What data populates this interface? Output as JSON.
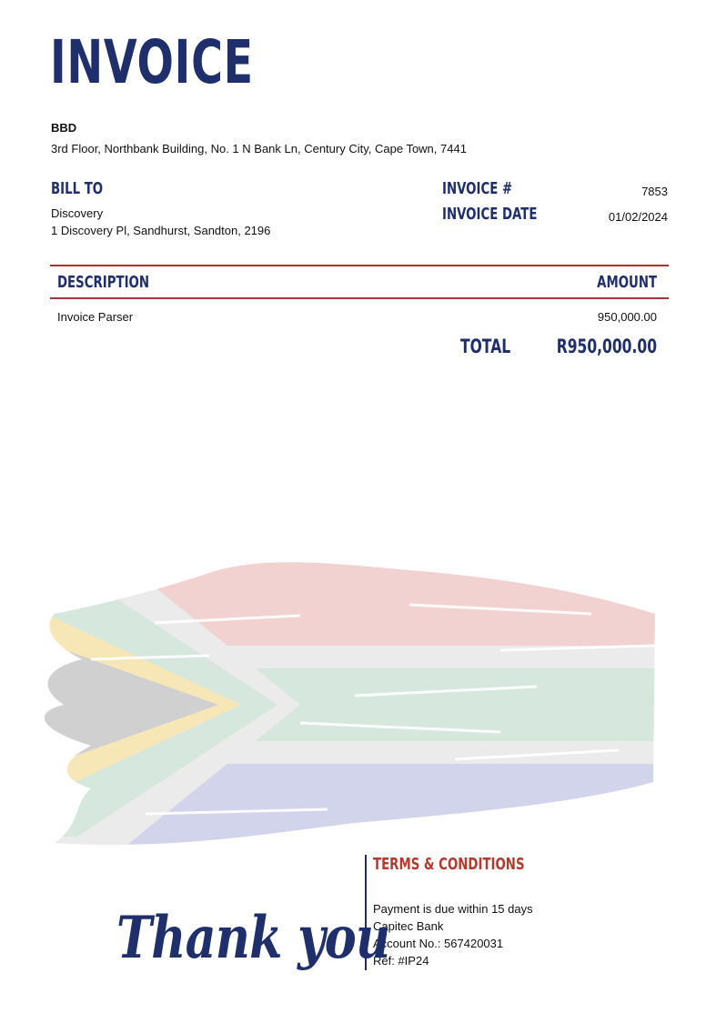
{
  "header": {
    "title": "INVOICE"
  },
  "company": {
    "name": "BBD",
    "address": "3rd Floor, Northbank Building, No. 1 N Bank Ln, Century City, Cape Town, 7441"
  },
  "bill_to": {
    "label": "BILL TO",
    "name": "Discovery",
    "address": "1 Discovery Pl, Sandhurst, Sandton, 2196"
  },
  "invoice_meta": {
    "number_label": "INVOICE #",
    "number": "7853",
    "date_label": "INVOICE DATE",
    "date": "01/02/2024"
  },
  "table": {
    "headers": {
      "description": "DESCRIPTION",
      "amount": "AMOUNT"
    },
    "rows": [
      {
        "description": "Invoice Parser",
        "amount": "950,000.00"
      }
    ],
    "total_label": "TOTAL",
    "total_value": "R950,000.00"
  },
  "colors": {
    "navy": "#1f2f6b",
    "red_rule": "#a83232",
    "terms_red": "#b43a2e"
  },
  "flag": {
    "icon": "south-africa-flag-brushstroke"
  },
  "footer": {
    "thank_you": "Thank you",
    "terms_title": "TERMS & CONDITIONS",
    "terms_lines": [
      "Payment is due within 15 days",
      "Capitec Bank",
      "Account No.: 567420031",
      "Ref: #IP24"
    ]
  }
}
